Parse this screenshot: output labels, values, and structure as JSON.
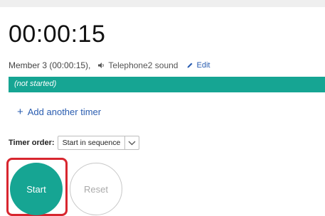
{
  "timer": {
    "display": "00:00:15",
    "member": "Member 3 (00:00:15),",
    "sound_icon": "speaker-icon",
    "sound_label": "Telephone2 sound",
    "edit_icon": "pencil-icon",
    "edit_label": "Edit",
    "status": "(not started)"
  },
  "actions": {
    "add_timer_icon": "plus-icon",
    "add_timer_label": "Add another timer"
  },
  "order": {
    "label": "Timer order:",
    "selected": "Start in sequence"
  },
  "controls": {
    "start_label": "Start",
    "reset_label": "Reset"
  },
  "colors": {
    "accent": "#16a593",
    "link": "#2a5db0",
    "highlight": "#d8262f"
  }
}
